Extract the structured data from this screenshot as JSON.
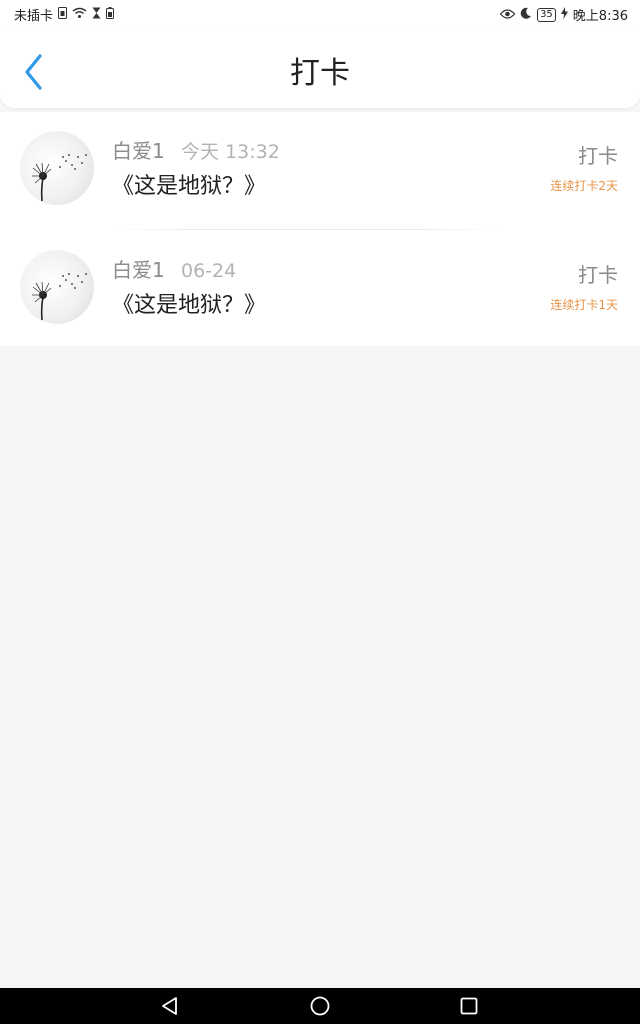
{
  "status_bar": {
    "carrier": "未插卡",
    "battery": "35",
    "time": "晚上8:36"
  },
  "header": {
    "title": "打卡",
    "accent_color": "#2e9bea"
  },
  "items": [
    {
      "user": "白爱1",
      "time": "今天 13:32",
      "title": "《这是地狱？》",
      "action": "打卡",
      "streak": "连续打卡2天"
    },
    {
      "user": "白爱1",
      "time": "06-24",
      "title": "《这是地狱？》",
      "action": "打卡",
      "streak": "连续打卡1天"
    }
  ],
  "colors": {
    "streak": "#e8944a",
    "background": "#f7f5f6"
  }
}
